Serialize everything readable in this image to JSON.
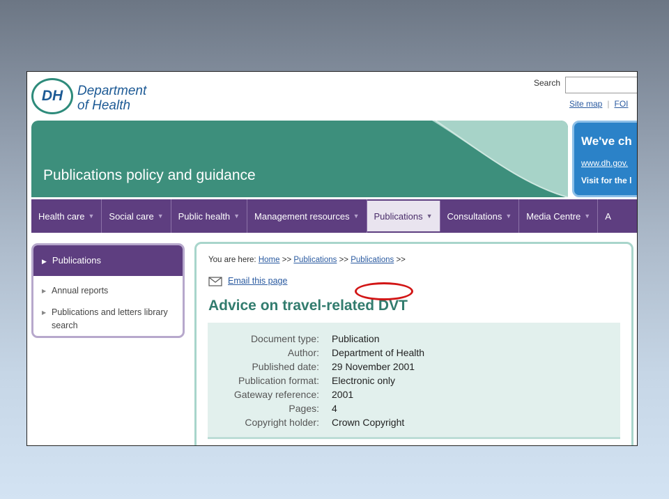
{
  "header": {
    "logo_mark": "DH",
    "logo_line1": "Department",
    "logo_line2": "of Health",
    "search_label": "Search",
    "search_value": "",
    "links": [
      "Site map",
      "FOI"
    ]
  },
  "banner": {
    "title": "Publications policy and guidance",
    "promo_head": "We've ch",
    "promo_url": "www.dh.gov.",
    "promo_sub": "Visit for the l"
  },
  "nav": {
    "items": [
      {
        "label": "Health care"
      },
      {
        "label": "Social care"
      },
      {
        "label": "Public health"
      },
      {
        "label": "Management resources"
      },
      {
        "label": "Publications"
      },
      {
        "label": "Consultations"
      },
      {
        "label": "Media Centre"
      },
      {
        "label": "A"
      }
    ],
    "active_index": 4
  },
  "sidebar": {
    "title": "Publications",
    "items": [
      {
        "label": "Annual reports"
      },
      {
        "label": "Publications and letters library search"
      }
    ]
  },
  "breadcrumb": {
    "prefix": "You are here:",
    "items": [
      "Home",
      "Publications",
      "Publications"
    ],
    "separator": ">>"
  },
  "email_link": "Email this page",
  "page_title": "Advice on travel-related DVT",
  "details": [
    {
      "label": "Document type:",
      "value": "Publication"
    },
    {
      "label": "Author:",
      "value": "Department of Health"
    },
    {
      "label": "Published date:",
      "value": "29 November 2001"
    },
    {
      "label": "Publication format:",
      "value": "Electronic only"
    },
    {
      "label": "Gateway reference:",
      "value": "2001"
    },
    {
      "label": "Pages:",
      "value": "4"
    },
    {
      "label": "Copyright holder:",
      "value": "Crown Copyright"
    }
  ],
  "colors": {
    "banner_green": "#3d8f7c",
    "nav_purple": "#5e3e80",
    "title_teal": "#327c6e",
    "link_blue": "#2a5aa0",
    "annotation_red": "#d21616"
  }
}
